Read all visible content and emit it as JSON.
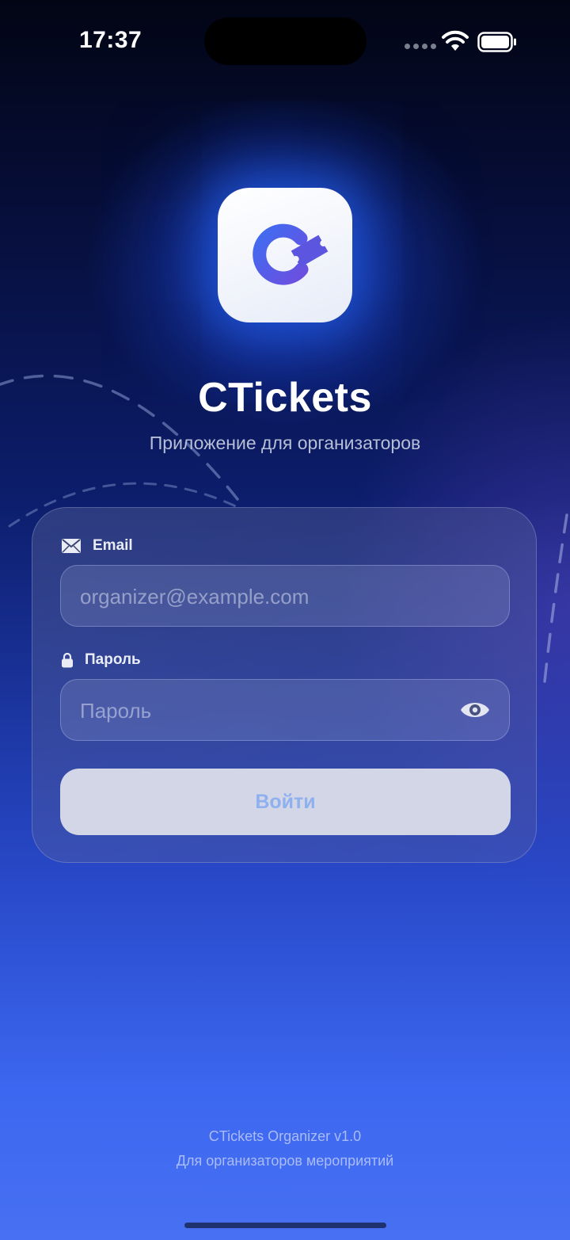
{
  "status_bar": {
    "time": "17:37"
  },
  "app": {
    "name": "CTickets",
    "subtitle": "Приложение для организаторов",
    "icon": "cticket-logo-icon"
  },
  "form": {
    "email_label": "Email",
    "email_icon": "envelope-icon",
    "email_placeholder": "organizer@example.com",
    "email_value": "",
    "password_label": "Пароль",
    "password_icon": "lock-icon",
    "password_placeholder": "Пароль",
    "password_value": "",
    "show_password_icon": "eye-icon",
    "login_label": "Войти"
  },
  "footer": {
    "version": "CTickets Organizer v1.0",
    "tagline": "Для организаторов мероприятий"
  },
  "colors": {
    "accent": "#5b55e0",
    "logo_blue": "#4a50e6",
    "button_bg": "#d3d6e6",
    "button_text": "#8fb0ef"
  }
}
